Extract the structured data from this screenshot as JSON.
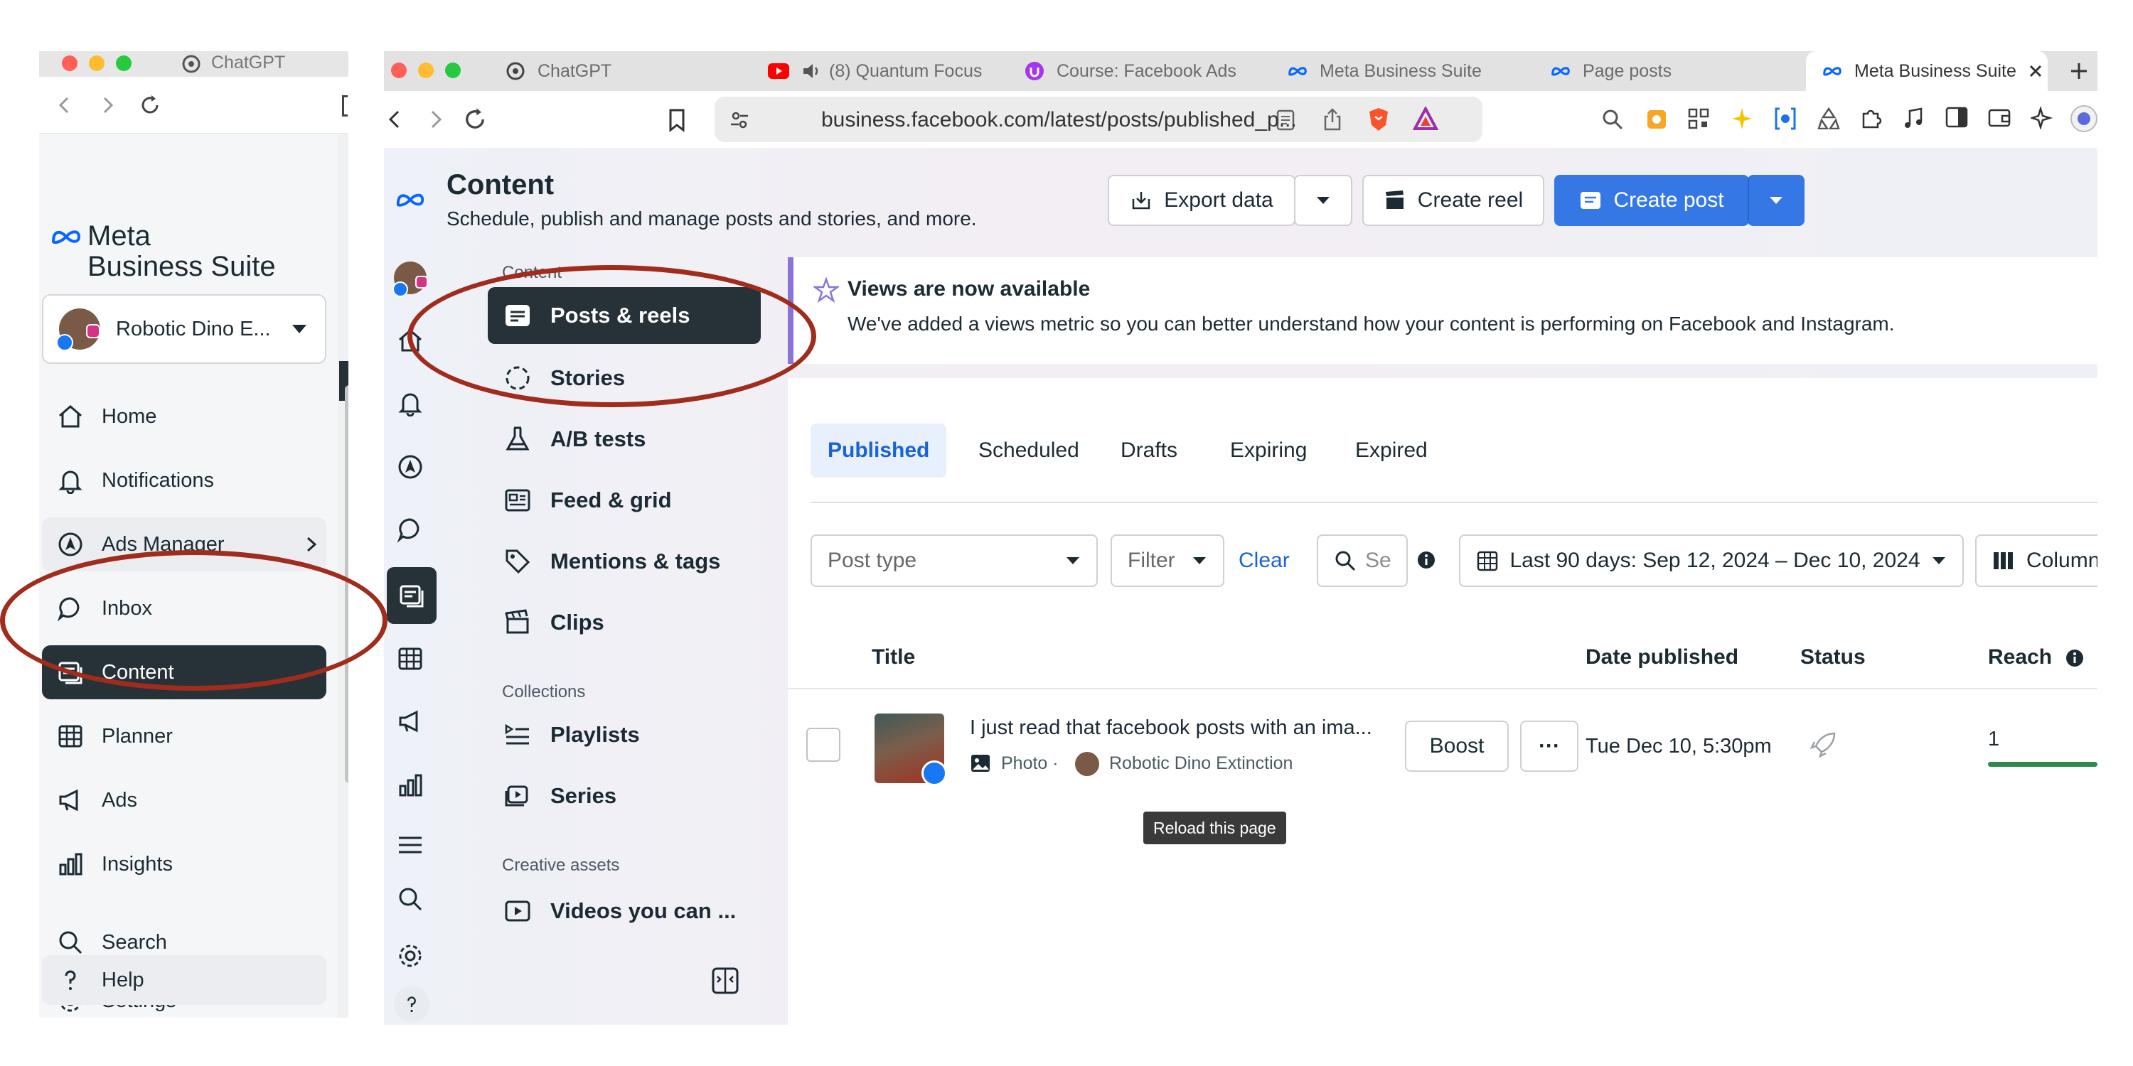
{
  "left_window": {
    "tab_title": "ChatGPT",
    "logo_line1": "Meta",
    "logo_line2": "Business Suite",
    "account_name": "Robotic Dino E...",
    "nav": [
      {
        "label": "Home",
        "icon": "home-icon"
      },
      {
        "label": "Notifications",
        "icon": "bell-icon"
      },
      {
        "label": "Ads Manager",
        "icon": "ads-manager-icon"
      },
      {
        "label": "Inbox",
        "icon": "chat-bubble-icon"
      },
      {
        "label": "Content",
        "icon": "content-icon",
        "active": true
      },
      {
        "label": "Planner",
        "icon": "calendar-grid-icon"
      },
      {
        "label": "Ads",
        "icon": "megaphone-icon"
      },
      {
        "label": "Insights",
        "icon": "bar-chart-icon"
      },
      {
        "label": "Search",
        "icon": "search-icon"
      },
      {
        "label": "Settings",
        "icon": "gear-icon"
      },
      {
        "label": "Help",
        "icon": "question-icon"
      }
    ]
  },
  "browser": {
    "tabs": [
      {
        "title": "ChatGPT",
        "icon": "openai-icon"
      },
      {
        "title": "(8) Quantum Focus",
        "icon": "youtube-icon"
      },
      {
        "title": "Course: Facebook Ads",
        "icon": "udemy-icon"
      },
      {
        "title": "Meta Business Suite",
        "icon": "meta-icon"
      },
      {
        "title": "Page posts",
        "icon": "meta-icon"
      },
      {
        "title": "Meta Business Suite",
        "icon": "meta-icon",
        "active": true
      }
    ],
    "url": "business.facebook.com/latest/posts/published_p..."
  },
  "page": {
    "title": "Content",
    "subtitle": "Schedule, publish and manage posts and stories, and more.",
    "export_label": "Export data",
    "create_reel_label": "Create reel",
    "create_post_label": "Create post"
  },
  "subnav": {
    "content_heading": "Content",
    "items": [
      {
        "label": "Posts & reels",
        "active": true
      },
      {
        "label": "Stories"
      },
      {
        "label": "A/B tests"
      },
      {
        "label": "Feed & grid"
      },
      {
        "label": "Mentions & tags"
      },
      {
        "label": "Clips"
      }
    ],
    "collections_heading": "Collections",
    "collections": [
      {
        "label": "Playlists"
      },
      {
        "label": "Series"
      }
    ],
    "creative_heading": "Creative assets",
    "creative": [
      {
        "label": "Videos you can ..."
      }
    ]
  },
  "banner": {
    "title": "Views are now available",
    "text": "We've added a views metric so you can better understand how your content is performing on Facebook and Instagram."
  },
  "status_tabs": [
    "Published",
    "Scheduled",
    "Drafts",
    "Expiring",
    "Expired"
  ],
  "filters": {
    "post_type_placeholder": "Post type",
    "filter_label": "Filter",
    "clear_label": "Clear",
    "search_placeholder": "Se",
    "date_range": "Last 90 days: Sep 12, 2024 – Dec 10, 2024",
    "columns_label": "Column"
  },
  "table": {
    "headers": {
      "title": "Title",
      "date": "Date published",
      "status": "Status",
      "reach": "Reach"
    },
    "rows": [
      {
        "title": "I just read that facebook posts with an ima...",
        "type": "Photo ·",
        "author": "Robotic Dino Extinction",
        "boost_label": "Boost",
        "more_label": "···",
        "date": "Tue Dec 10, 5:30pm",
        "reach": "1"
      }
    ]
  },
  "tooltip": "Reload this page",
  "colors": {
    "annotation_red": "#a02c1c",
    "active_nav": "#263238",
    "primary_blue": "#3578e5",
    "link_blue": "#1a63d6"
  }
}
